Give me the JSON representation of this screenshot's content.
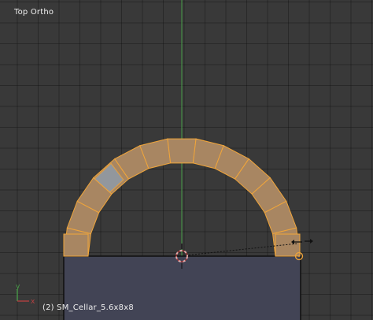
{
  "viewport": {
    "view_name": "Top Ortho",
    "object_info": "(2) SM_Cellar_5.6x8x8",
    "axis_widget": {
      "y_label": "y",
      "x_label": "x"
    }
  },
  "colors": {
    "background": "#393939",
    "grid_line": "#2e2e2e",
    "y_axis": "#49a049",
    "x_axis": "#b84040",
    "brick_fill": "#a88662",
    "brick_edge": "#f0a53a",
    "selected_face": "#8f9aa8",
    "cellar_body": "#424455",
    "cellar_outline": "#0f0f0f",
    "cursor_red": "#e0b0b0",
    "pivot_orange": "#f0a53a"
  },
  "icons": [
    "3d-cursor-icon",
    "scale-arrow-icon",
    "axis-widget-icon"
  ]
}
